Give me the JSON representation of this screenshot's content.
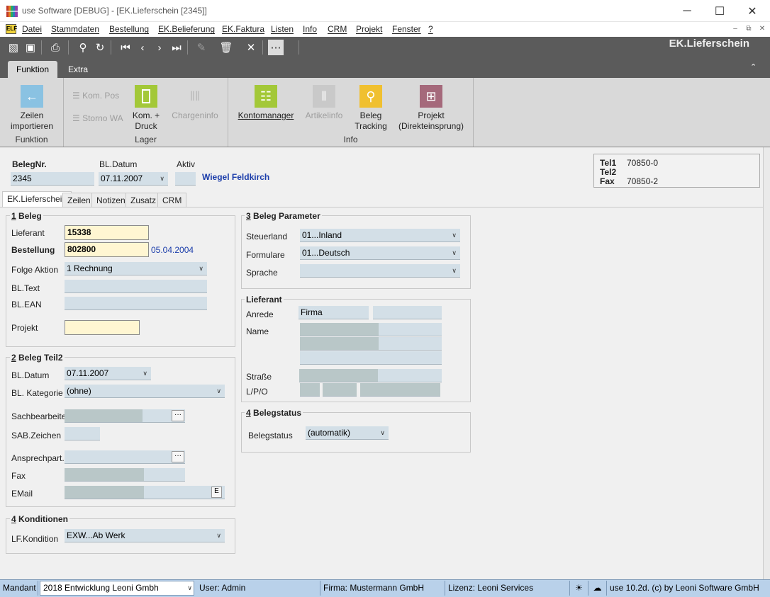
{
  "window": {
    "title": "use Software [DEBUG] - [EK.Lieferschein [2345]]",
    "form_title": "EK.Lieferschein"
  },
  "menu": [
    "Datei",
    "Stammdaten",
    "Bestellung",
    "EK.Belieferung",
    "EK.Faktura",
    "Listen",
    "Info",
    "CRM",
    "Projekt",
    "Fenster",
    "?"
  ],
  "menu_badge": "ELF",
  "ribbon": {
    "tabs": [
      "Funktion",
      "Extra"
    ],
    "groups": {
      "funktion": {
        "label": "Funktion",
        "button": "Zeilen importieren"
      },
      "lager": {
        "label": "Lager",
        "small": [
          "Kom. Pos",
          "Storno WA"
        ],
        "buttons": [
          "Kom. + Druck",
          "Chargeninfo"
        ]
      },
      "info": {
        "label": "Info",
        "buttons": [
          "Kontomanager",
          "Artikelinfo",
          "Beleg Tracking",
          "Projekt (Direkteinsprung)"
        ]
      }
    }
  },
  "header": {
    "beleg_label": "BelegNr.",
    "beleg_value": "2345",
    "datum_label": "BL.Datum",
    "datum_value": "07.11.2007",
    "aktiv_label": "Aktiv",
    "aktiv_value": "",
    "company": "Wiegel Feldkirch"
  },
  "contact": [
    {
      "label": "Tel1",
      "value": "70850-0"
    },
    {
      "label": "Tel2",
      "value": ""
    },
    {
      "label": "Fax",
      "value": "70850-2"
    }
  ],
  "tabs": [
    "EK.Lieferschein",
    "Zeilen",
    "Notizen",
    "Zusatz",
    "CRM"
  ],
  "beleg": {
    "num": "1",
    "title": "Beleg",
    "lieferant_label": "Lieferant",
    "lieferant_value": "15338",
    "bestellung_label": "Bestellung",
    "bestellung_value": "802800",
    "bestellung_date": "05.04.2004",
    "folge_label": "Folge Aktion",
    "folge_value": "1 Rechnung",
    "text_label": "BL.Text",
    "ean_label": "BL.EAN",
    "projekt_label": "Projekt"
  },
  "teil2": {
    "num": "2",
    "title": "Beleg Teil2",
    "datum_label": "BL.Datum",
    "datum_value": "07.11.2007",
    "kategorie_label": "BL. Kategorie",
    "kategorie_value": "(ohne)",
    "sach_label": "Sachbearbeiter",
    "sab_label": "SAB.Zeichen",
    "ansp_label": "Ansprechpart.",
    "fax_label": "Fax",
    "email_label": "EMail",
    "email_btn": "E",
    "more_btn": "···"
  },
  "konditionen": {
    "num": "4",
    "title": "Konditionen",
    "label": "LF.Kondition",
    "value": "EXW...Ab Werk"
  },
  "parameter": {
    "num": "3",
    "title": "Beleg Parameter",
    "steuer_label": "Steuerland",
    "steuer_value": "01...Inland",
    "form_label": "Formulare",
    "form_value": "01...Deutsch",
    "sprache_label": "Sprache",
    "sprache_value": ""
  },
  "lieferant": {
    "title": "Lieferant",
    "anrede_label": "Anrede",
    "anrede_value": "Firma",
    "name_label": "Name",
    "strasse_label": "Straße",
    "lpo_label": "L/P/O"
  },
  "belegstatus": {
    "num": "4",
    "title": "Belegstatus",
    "label": "Belegstatus",
    "value": "(automatik)"
  },
  "statusbar": {
    "mandant_label": "Mandant",
    "mandant_value": "2018  Entwicklung Leoni Gmbh",
    "user": "User: Admin",
    "firma": "Firma: Mustermann GmbH",
    "lizenz": "Lizenz: Leoni Services",
    "version": "use 10.2d. (c) by Leoni Software GmbH"
  },
  "colors": {
    "toolbar": "#5b5b5b",
    "ribbon": "#d9d9d9",
    "input": "#d3dfe7",
    "required": "#fff6d2",
    "status": "#b9d1ea",
    "company": "#1a3caa"
  }
}
